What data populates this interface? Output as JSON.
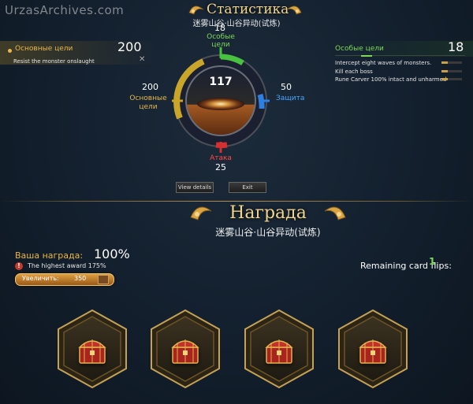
{
  "watermark": "UrzasArchives.com",
  "stats": {
    "title": "Статистика",
    "subtitle": "迷雾山谷·山谷异动(试炼)",
    "center_value": "117",
    "top": {
      "label": "Особые цели",
      "value": "18"
    },
    "left": {
      "label_line1": "Основные",
      "label_line2": "цели",
      "value": "200"
    },
    "right": {
      "label": "Защита",
      "value": "50"
    },
    "bottom": {
      "label": "Атака",
      "value": "25"
    },
    "buttons": {
      "view": "View details",
      "exit": "Exit"
    }
  },
  "left_panel": {
    "title": "Основные цели",
    "score": "200",
    "objectives": [
      {
        "text": "Resist the monster onslaught"
      }
    ]
  },
  "right_panel": {
    "title": "Особые цели",
    "score": "18",
    "objectives": [
      {
        "text": "Intercept eight waves of monsters."
      },
      {
        "text": "Kill each boss"
      },
      {
        "text": "Rune Carver 100% intact and unharmed"
      }
    ]
  },
  "reward": {
    "title": "Награда",
    "subtitle": "迷雾山谷·山谷异动(试炼)",
    "your_reward_label": "Ваша награда:",
    "your_reward_value": "100%",
    "highest_award": "The highest award 175%",
    "increase_label": "Увеличить:",
    "increase_cost": "350",
    "remaining_flips_label": "Remaining card flips:",
    "remaining_flips_value": "1"
  },
  "colors": {
    "gold": "#e8b84a",
    "green": "#7ed957",
    "blue": "#4aa8ff",
    "red": "#ff4a4a",
    "dial_fill_orange": "#c9682a"
  },
  "cards": [
    {
      "icon": "treasure-chest-icon"
    },
    {
      "icon": "treasure-chest-icon"
    },
    {
      "icon": "treasure-chest-icon"
    },
    {
      "icon": "treasure-chest-icon"
    }
  ]
}
